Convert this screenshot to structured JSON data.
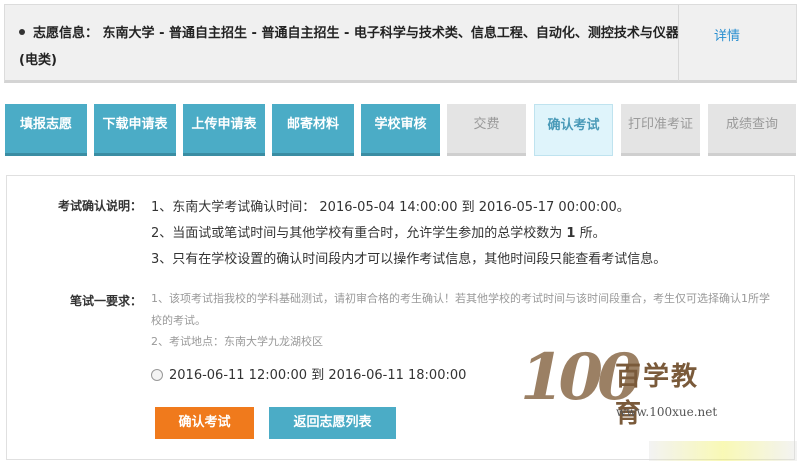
{
  "info": {
    "label": "志愿信息：",
    "text": "东南大学 - 普通自主招生 - 普通自主招生 - 电子科学与技术类、信息工程、自动化、测控技术与仪器(电类)",
    "detail_link": "详情"
  },
  "steps": [
    {
      "label": "填报志愿",
      "state": "done"
    },
    {
      "label": "下载申请表",
      "state": "done"
    },
    {
      "label": "上传申请表",
      "state": "done"
    },
    {
      "label": "邮寄材料",
      "state": "done"
    },
    {
      "label": "学校审核",
      "state": "done"
    },
    {
      "label": "交费",
      "state": "pending"
    },
    {
      "label": "确认考试",
      "state": "current"
    },
    {
      "label": "打印准考证",
      "state": "pending"
    },
    {
      "label": "成绩查询",
      "state": "pending"
    }
  ],
  "exam_notes": {
    "label": "考试确认说明：",
    "lines": [
      "1、东南大学考试确认时间： 2016-05-04 14:00:00 到 2016-05-17 00:00:00。",
      "2、当面试或笔试时间与其他学校有重合时，允许学生参加的总学校数为 1 所。",
      "3、只有在学校设置的确认时间段内才可以操作考试信息，其他时间段只能查看考试信息。"
    ]
  },
  "requirement": {
    "label": "笔试一要求：",
    "lines": [
      "1、该项考试指我校的学科基础测试，请初审合格的考生确认！若其他学校的考试时间与该时间段重合，考生仅可选择确认1所学校的考试。",
      "2、考试地点：东南大学九龙湖校区"
    ],
    "option": "2016-06-11 12:00:00 到 2016-06-11 18:00:00"
  },
  "buttons": {
    "confirm": "确认考试",
    "back": "返回志愿列表"
  },
  "watermark": {
    "logo_number": "100",
    "logo_text": "百学教育",
    "url": "www.100xue.net"
  },
  "colors": {
    "step_done": "#4bacc6",
    "step_current": "#dff4fb",
    "step_pending": "#e4e4e4",
    "confirm_button": "#f07a1c",
    "link": "#2a8fd0"
  }
}
